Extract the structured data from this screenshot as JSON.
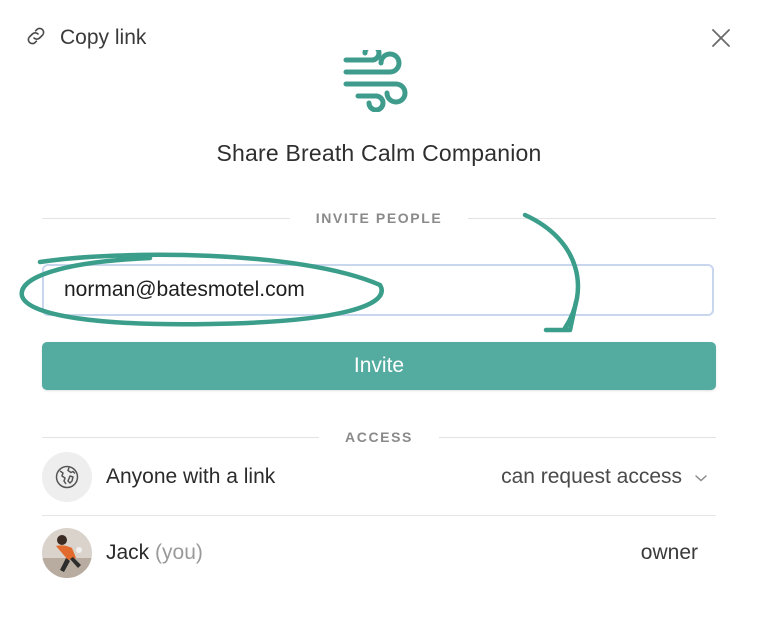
{
  "header": {
    "copy_link_label": "Copy link",
    "copy_link_icon": "link-icon",
    "close_icon": "close-icon",
    "logo_icon": "wind-icon",
    "title": "Share Breath Calm Companion"
  },
  "invite": {
    "section_label": "INVITE PEOPLE",
    "email_value": "norman@batesmotel.com",
    "button_label": "Invite"
  },
  "access": {
    "section_label": "ACCESS",
    "link_row": {
      "icon": "globe-icon",
      "label": "Anyone with a link",
      "permission": "can request access",
      "dropdown_icon": "chevron-down-icon"
    },
    "users": [
      {
        "name": "Jack",
        "you_tag": "(you)",
        "role": "owner"
      }
    ]
  },
  "colors": {
    "accent": "#54ab9f",
    "annotation": "#3a9e8a"
  }
}
